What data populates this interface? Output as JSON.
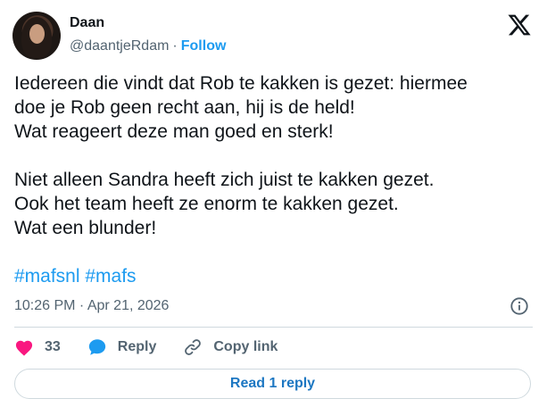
{
  "author": {
    "name": "Daan",
    "handle": "@daantjeRdam",
    "separator": "·",
    "follow_label": "Follow"
  },
  "tweet": {
    "paragraphs": [
      [
        "Iedereen die vindt dat Rob te kakken is gezet: hiermee",
        "doe je Rob geen recht aan, hij is de held!",
        "Wat reageert deze man goed en sterk!"
      ],
      [
        "Niet alleen Sandra heeft zich juist te kakken gezet.",
        "Ook het team heeft ze enorm te kakken gezet.",
        "Wat een blunder!"
      ]
    ],
    "hashtags": [
      "#mafsnl",
      "#mafs"
    ],
    "timestamp": "10:26 PM · Apr 21, 2026"
  },
  "actions": {
    "like_count": "33",
    "reply_label": "Reply",
    "copy_label": "Copy link"
  },
  "read_replies_label": "Read 1 reply",
  "colors": {
    "accent": "#1d9bf0",
    "like": "#f91880",
    "text": "#0f1419",
    "muted": "#536471",
    "border": "#cfd9de"
  },
  "icons": [
    "x-logo-icon",
    "info-icon",
    "heart-icon",
    "reply-bubble-icon",
    "link-icon"
  ]
}
